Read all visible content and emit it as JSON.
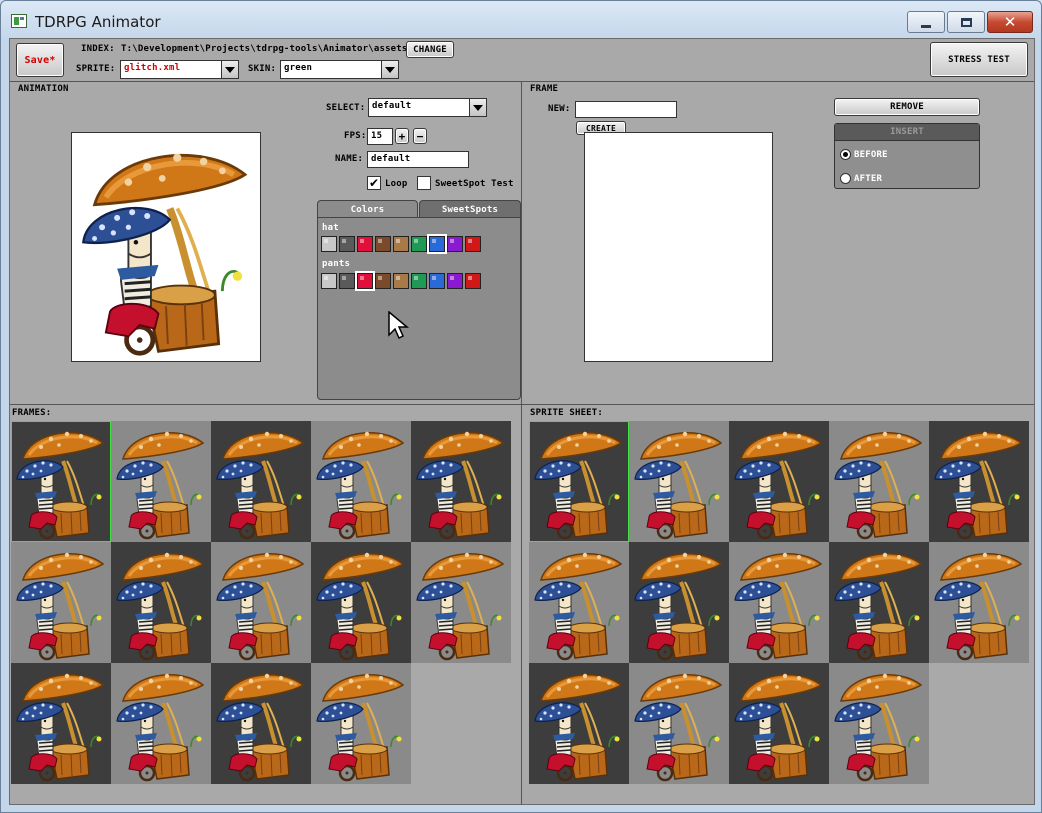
{
  "window": {
    "title": "TDRPG Animator"
  },
  "toolbar": {
    "save_label": "Save*",
    "index_label": "INDEX:",
    "index_path": "T:\\Development\\Projects\\tdrpg-tools\\Animator\\assets",
    "change_label": "CHANGE",
    "sprite_label": "SPRITE:",
    "sprite_value": "glitch.xml",
    "skin_label": "SKIN:",
    "skin_value": "green",
    "stress_label": "STRESS TEST"
  },
  "animation": {
    "title": "ANIMATION",
    "select_label": "SELECT:",
    "select_value": "default",
    "fps_label": "FPS:",
    "fps_value": "15",
    "fps_plus": "+",
    "fps_minus": "−",
    "name_label": "NAME:",
    "name_value": "default",
    "loop_label": "Loop",
    "loop_checked": true,
    "sweetspot_test_label": "SweetSpot Test",
    "sweetspot_test_checked": false,
    "tabs": [
      {
        "label": "Colors"
      },
      {
        "label": "SweetSpots"
      }
    ],
    "color_groups": [
      {
        "name": "hat",
        "colors": [
          "#c8c8c8",
          "#5a5a5a",
          "#e0103a",
          "#7a4a2a",
          "#a87a48",
          "#1f9a55",
          "#2a6ad8",
          "#8a1ad0",
          "#d01818"
        ],
        "selected": 6
      },
      {
        "name": "pants",
        "colors": [
          "#c8c8c8",
          "#5a5a5a",
          "#e0103a",
          "#7a4a2a",
          "#a87a48",
          "#1f9a55",
          "#2a6ad8",
          "#8a1ad0",
          "#d01818"
        ],
        "selected": 2
      }
    ]
  },
  "frame": {
    "title": "FRAME",
    "new_label": "NEW:",
    "new_value": "",
    "create_label": "CREATE",
    "remove_label": "REMOVE",
    "insert_label": "INSERT",
    "before_label": "BEFORE",
    "after_label": "AFTER",
    "before_selected": true
  },
  "frames": {
    "title": "FRAMES:",
    "count": 14,
    "selected": 0
  },
  "spritesheet": {
    "title": "SPRITE SHEET:",
    "count": 14,
    "selected": 0
  },
  "colors": {
    "accent_red": "#d00000",
    "panel": "#a9a9a9",
    "dark_cell": "#3d3d3d",
    "light_cell": "#8a8a8a",
    "highlight": "#3fe23f"
  }
}
